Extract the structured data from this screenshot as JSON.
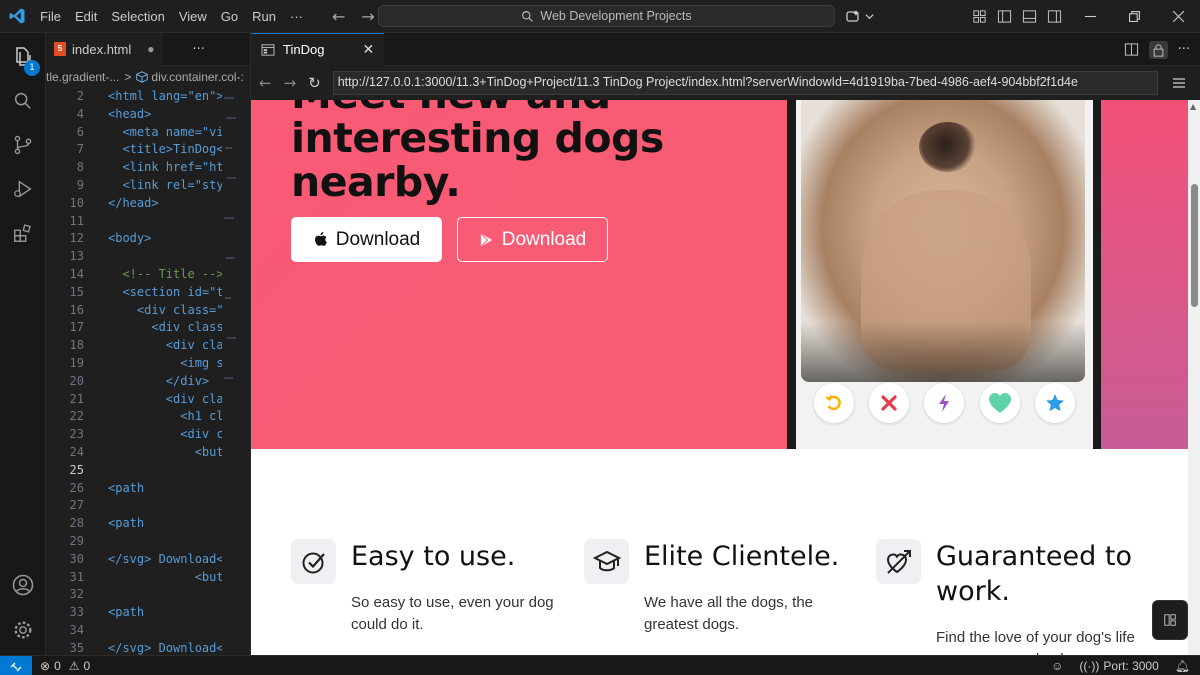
{
  "titlebar": {
    "menu": [
      "File",
      "Edit",
      "Selection",
      "View",
      "Go",
      "Run",
      "···"
    ],
    "search_text": "Web Development Projects"
  },
  "activity": {
    "explorer_badge": "1"
  },
  "editor": {
    "tab_label": "index.html",
    "breadcrumb_1": "tle.gradient-...",
    "breadcrumb_sep": ">",
    "breadcrumb_2": "div.container.col-:",
    "lines": [
      {
        "n": "2",
        "code": "<html lang=\"en\">"
      },
      {
        "n": "4",
        "code": "<head>"
      },
      {
        "n": "6",
        "code": "  <meta name=\"vi"
      },
      {
        "n": "7",
        "code": "  <title>TinDog<"
      },
      {
        "n": "8",
        "code": "  <link href=\"ht"
      },
      {
        "n": "9",
        "code": "  <link rel=\"sty"
      },
      {
        "n": "10",
        "code": "</head>"
      },
      {
        "n": "11",
        "code": ""
      },
      {
        "n": "12",
        "code": "<body>"
      },
      {
        "n": "13",
        "code": ""
      },
      {
        "n": "14",
        "code": "  <!-- Title -->"
      },
      {
        "n": "15",
        "code": "  <section id=\"t"
      },
      {
        "n": "16",
        "code": "    <div class=\""
      },
      {
        "n": "17",
        "code": "      <div class"
      },
      {
        "n": "18",
        "code": "        <div cla"
      },
      {
        "n": "19",
        "code": "          <img s"
      },
      {
        "n": "20",
        "code": "        </div>"
      },
      {
        "n": "21",
        "code": "        <div cla"
      },
      {
        "n": "22",
        "code": "          <h1 cl"
      },
      {
        "n": "23",
        "code": "          <div c"
      },
      {
        "n": "24",
        "code": "            <but"
      },
      {
        "n": "25",
        "code": ""
      },
      {
        "n": "26",
        "code": "<path"
      },
      {
        "n": "27",
        "code": ""
      },
      {
        "n": "28",
        "code": "<path"
      },
      {
        "n": "29",
        "code": ""
      },
      {
        "n": "30",
        "code": "</svg> Download<"
      },
      {
        "n": "31",
        "code": "            <but"
      },
      {
        "n": "32",
        "code": ""
      },
      {
        "n": "33",
        "code": "<path"
      },
      {
        "n": "34",
        "code": ""
      },
      {
        "n": "35",
        "code": "</svg> Download<"
      }
    ]
  },
  "browser": {
    "tab_label": "TinDog",
    "url": "http://127.0.0.1:3000/11.3+TinDog+Project/11.3 TinDog Project/index.html?serverWindowId=4d1919ba-7bed-4986-aef4-904bbf2f1d4e"
  },
  "page": {
    "headline": "Meet new and interesting dogs nearby.",
    "download_apple": "Download",
    "download_google": "Download",
    "features": [
      {
        "title": "Easy to use.",
        "text": "So easy to use, even your dog could do it.",
        "icon": "check-circle-icon"
      },
      {
        "title": "Elite Clientele.",
        "text": "We have all the dogs, the greatest dogs.",
        "icon": "graduation-cap-icon"
      },
      {
        "title": "Guaranteed to work.",
        "text": "Find the love of your dog's life or your money back.",
        "icon": "heart-arrow-icon"
      }
    ]
  },
  "status": {
    "errors": "0",
    "warnings": "0",
    "port": "Port: 3000"
  },
  "colors": {
    "hero": "#f95a76",
    "accent": "#0078d4"
  }
}
